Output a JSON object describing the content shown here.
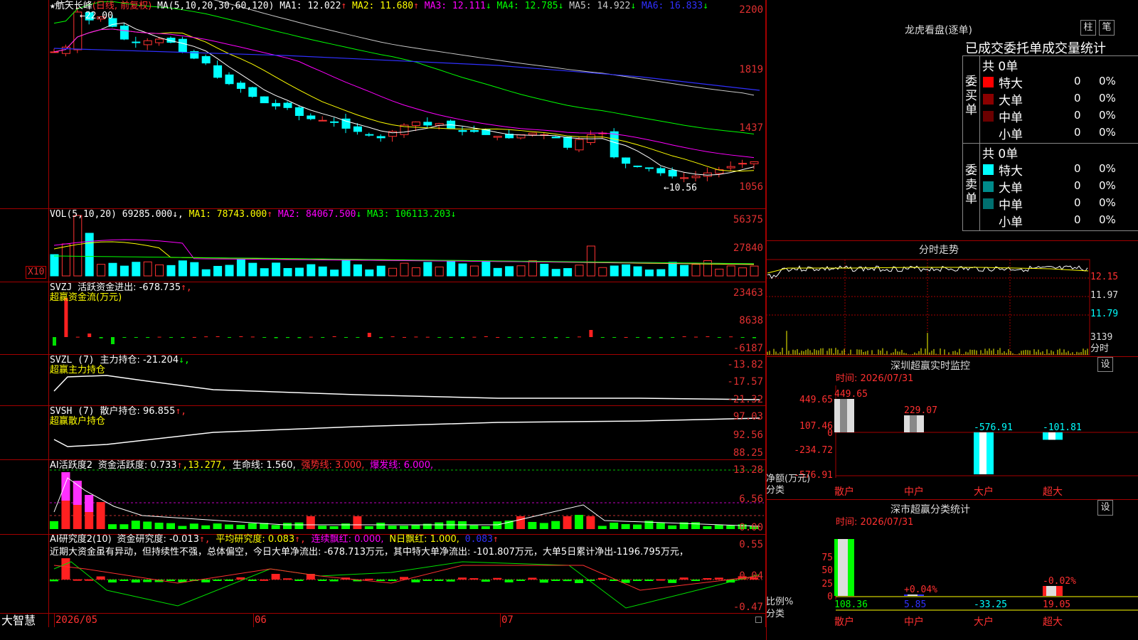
{
  "brand": "大智慧",
  "k_panel": {
    "star": "★",
    "name": "航天长峰",
    "mode": "(日线, 前复权)",
    "ma_label": "MA(5,10,20,30,60,120)",
    "ma": [
      {
        "label": "MA1:",
        "value": "12.022",
        "arrow": "↑",
        "color": "#ffffff"
      },
      {
        "label": "MA2:",
        "value": "11.680",
        "arrow": "↑",
        "color": "#ffff00"
      },
      {
        "label": "MA3:",
        "value": "12.111",
        "arrow": "↓",
        "color": "#ff00ff"
      },
      {
        "label": "MA4:",
        "value": "12.785",
        "arrow": "↓",
        "color": "#00ff00"
      },
      {
        "label": "MA5:",
        "value": "14.922",
        "arrow": "↓",
        "color": "#c8c8c8"
      },
      {
        "label": "MA6:",
        "value": "16.833",
        "arrow": "↓",
        "color": "#3030ff"
      }
    ],
    "axis": [
      "2200",
      "1819",
      "1437",
      "1056"
    ],
    "high_marker": "←22.00",
    "low_marker": "←10.56"
  },
  "vol_panel": {
    "label": "VOL(5,10,20)",
    "value": "69285.000↓,",
    "ma": [
      {
        "label": "MA1:",
        "value": "78743.000",
        "arrow": "↑",
        "color": "#ffff00"
      },
      {
        "label": "MA2:",
        "value": "84067.500",
        "arrow": "↓",
        "color": "#ff00ff"
      },
      {
        "label": "MA3:",
        "value": "106113.203",
        "arrow": "↓",
        "color": "#00ff00"
      }
    ],
    "axis": [
      "56375",
      "27840"
    ],
    "multiplier": "X10"
  },
  "svzj_panel": {
    "label": "SVZJ",
    "desc": "活跃资金进出: -678.735",
    "arrow": "↑,",
    "sub": "超赢资金流(万元)",
    "axis": [
      "23463",
      "8638",
      "-6187"
    ]
  },
  "svzl_panel": {
    "label": "SVZL (7)",
    "desc": "主力持仓: -21.204",
    "arrow": "↓,",
    "sub": "超赢主力持仓",
    "axis": [
      "-13.82",
      "-17.57",
      "-21.32"
    ]
  },
  "svsh_panel": {
    "label": "SVSH (7)",
    "desc": "散户持仓: 96.855",
    "arrow": "↑,",
    "sub": "超赢散户持仓",
    "axis": [
      "97.03",
      "92.56",
      "88.25"
    ]
  },
  "ai_active": {
    "label": "AI活跃度2",
    "desc": "资金活跃度: 0.733",
    "a1": "↑",
    "v2": ",13.277,",
    "life": "生命线: 1.560,",
    "strong": "强势线: 3.000,",
    "burst": "爆发线: 6.000,",
    "axis": [
      "13.28",
      "6.56",
      "0.00"
    ]
  },
  "ai_research": {
    "label": "AI研究度2(10)",
    "desc": "资金研究度: -0.013",
    "a1": "↑,",
    "avg": "平均研究度: 0.083",
    "a2": "↑,",
    "cont": "连续飘红: 0.000,",
    "nday": "N日飘红: 1.000,",
    "last": "0.083",
    "a3": "↑",
    "text": "近期大资金虽有异动，但持续性不强，总体偏空，今日大单净流出: -678.713万元，其中特大单净流出: -101.807万元，大单5日累计净出-1196.795万元，",
    "axis": [
      "0.55",
      "0.04",
      "-0.47"
    ]
  },
  "date_axis": [
    "2026/05",
    "06",
    "07"
  ],
  "lhb": {
    "title": "龙虎看盘(逐单)",
    "btn_zhu": "柱",
    "btn_bi": "笔",
    "subtitle": "已成交委托单成交量统计",
    "buy": {
      "side": "委买单",
      "total": "共 0单",
      "rows": [
        {
          "name": "特大",
          "count": "0",
          "pct": "0%",
          "color": "#ff0000"
        },
        {
          "name": "大单",
          "count": "0",
          "pct": "0%",
          "color": "#8b0000"
        },
        {
          "name": "中单",
          "count": "0",
          "pct": "0%",
          "color": "#6b0000"
        },
        {
          "name": "小单",
          "count": "0",
          "pct": "0%",
          "color": ""
        }
      ]
    },
    "sell": {
      "side": "委卖单",
      "total": "共 0单",
      "rows": [
        {
          "name": "特大",
          "count": "0",
          "pct": "0%",
          "color": "#00ffff"
        },
        {
          "name": "大单",
          "count": "0",
          "pct": "0%",
          "color": "#008b8b"
        },
        {
          "name": "中单",
          "count": "0",
          "pct": "0%",
          "color": "#007070"
        },
        {
          "name": "小单",
          "count": "0",
          "pct": "0%",
          "color": ""
        }
      ]
    }
  },
  "fenshi": {
    "title": "分时走势",
    "axis": [
      "12.15",
      "11.97",
      "11.79",
      "3139"
    ],
    "unit": "分时"
  },
  "sz_monitor": {
    "title": "深圳超赢实时监控",
    "btn": "设",
    "time": "时间: 2026/07/31",
    "axis": [
      "449.65",
      "107.46",
      "0",
      "-234.72",
      "-576.91"
    ],
    "ylabel1": "净额(万元)",
    "ylabel2": "分类",
    "bars": [
      {
        "cat": "散户",
        "value": 449.65,
        "label": "449.65"
      },
      {
        "cat": "中户",
        "value": 229.07,
        "label": "229.07"
      },
      {
        "cat": "大户",
        "value": -576.91,
        "label": "-576.91"
      },
      {
        "cat": "超大",
        "value": -101.81,
        "label": "-101.81"
      }
    ]
  },
  "sz_class": {
    "title": "深市超赢分类统计",
    "btn": "设",
    "time": "时间: 2026/07/31",
    "axis": [
      "75",
      "50",
      "25",
      "0"
    ],
    "ylabel1": "比例%",
    "ylabel2": "分类",
    "bars": [
      {
        "cat": "散户",
        "value": 108.36,
        "label": "108.36",
        "top": ""
      },
      {
        "cat": "中户",
        "value": 5.85,
        "label": "5.85",
        "top": "+0.04%"
      },
      {
        "cat": "大户",
        "value": -33.25,
        "label": "-33.25",
        "top": ""
      },
      {
        "cat": "超大",
        "value": 19.05,
        "label": "19.05",
        "top": "-0.02%"
      }
    ]
  }
}
